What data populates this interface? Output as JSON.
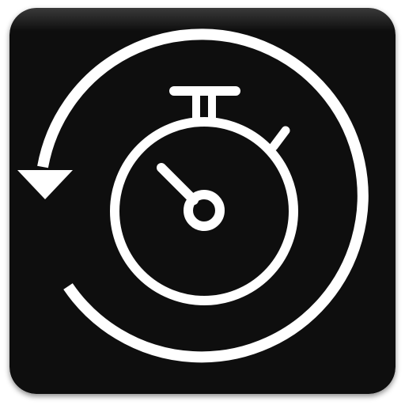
{
  "app_icon": {
    "icon_name": "stopwatch-reset-icon",
    "colors": {
      "tile_top": "#3a3a3a",
      "tile_bottom": "#0e0e0e",
      "glyph": "#ffffff"
    }
  }
}
